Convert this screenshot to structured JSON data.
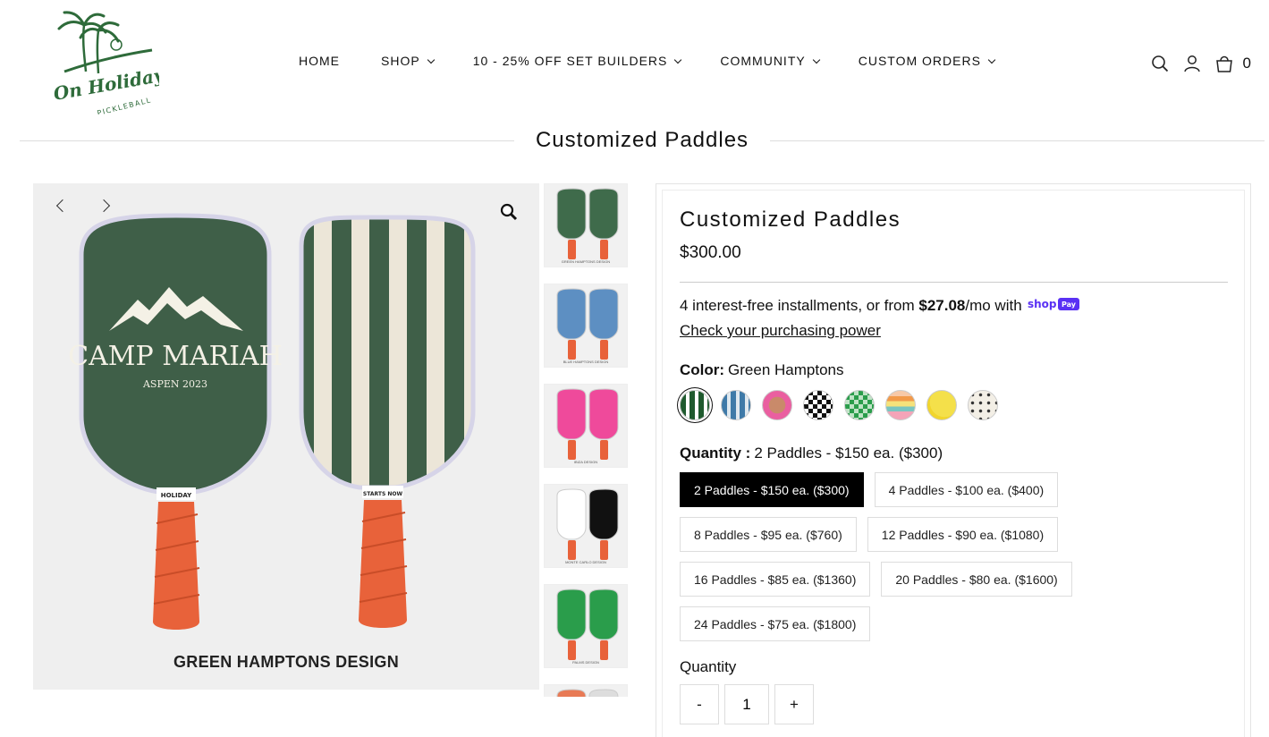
{
  "brand": {
    "logo_text_top": "On Holiday",
    "logo_text_bottom": "PICKLEBALL"
  },
  "nav": [
    {
      "label": "HOME",
      "dropdown": false
    },
    {
      "label": "SHOP",
      "dropdown": true
    },
    {
      "label": "10 - 25% OFF SET BUILDERS",
      "dropdown": true
    },
    {
      "label": "COMMUNITY",
      "dropdown": true
    },
    {
      "label": "CUSTOM ORDERS",
      "dropdown": true
    }
  ],
  "header": {
    "cart_count": "0",
    "icons": [
      "search-icon",
      "account-icon",
      "cart-icon"
    ]
  },
  "page_title": "Customized Paddles",
  "gallery": {
    "caption": "GREEN HAMPTONS DESIGN",
    "main_paddle_text": "CAMP MARIAH",
    "main_paddle_subtext": "ASPEN 2023",
    "left_collar": "HOLIDAY",
    "right_collar": "STARTS NOW",
    "thumbs": [
      {
        "caption": "GREEN HAMPTONS DESIGN",
        "left": "#3f6b4b",
        "right": "#3f6b4b"
      },
      {
        "caption": "BLUE HAMPTONS DESIGN",
        "left": "#5d8fc2",
        "right": "#5d8fc2"
      },
      {
        "caption": "IBIZA DESIGN",
        "left": "#ef4a9b",
        "right": "#ef4a9b"
      },
      {
        "caption": "MONTE CARLO DESIGN",
        "left": "#ffffff",
        "right": "#111111"
      },
      {
        "caption": "PALMS DESIGN",
        "left": "#2a9d4b",
        "right": "#2a9d4b"
      },
      {
        "caption": "",
        "left": "#e87a55",
        "right": "#dddddd"
      }
    ]
  },
  "product": {
    "title": "Customized Paddles",
    "price": "$300.00",
    "shoppay_pre": "4 interest-free installments, or from ",
    "shoppay_amount": "$27.08",
    "shoppay_post": "/mo with ",
    "shoppay_logo": "shop Pay",
    "shoppay_link": "Check your purchasing power",
    "color_label": "Color:",
    "color_value": "Green Hamptons",
    "swatches": [
      "green-stripe",
      "blue-stripe",
      "pink",
      "black-check",
      "green-check",
      "rainbow",
      "yellow-ball",
      "cream-pattern"
    ],
    "quantity_label": "Quantity :",
    "quantity_value": "2 Paddles - $150 ea. ($300)",
    "options": [
      [
        "2 Paddles - $150 ea. ($300)",
        "4 Paddles - $100 ea. ($400)"
      ],
      [
        "8 Paddles - $95 ea. ($760)",
        "12 Paddles - $90 ea. ($1080)"
      ],
      [
        "16 Paddles - $85 ea. ($1360)",
        "20 Paddles - $80 ea. ($1600)"
      ],
      [
        "24 Paddles - $75 ea. ($1800)"
      ]
    ],
    "qty_heading": "Quantity",
    "qty_minus": "-",
    "qty_value": "1",
    "qty_plus": "+"
  }
}
